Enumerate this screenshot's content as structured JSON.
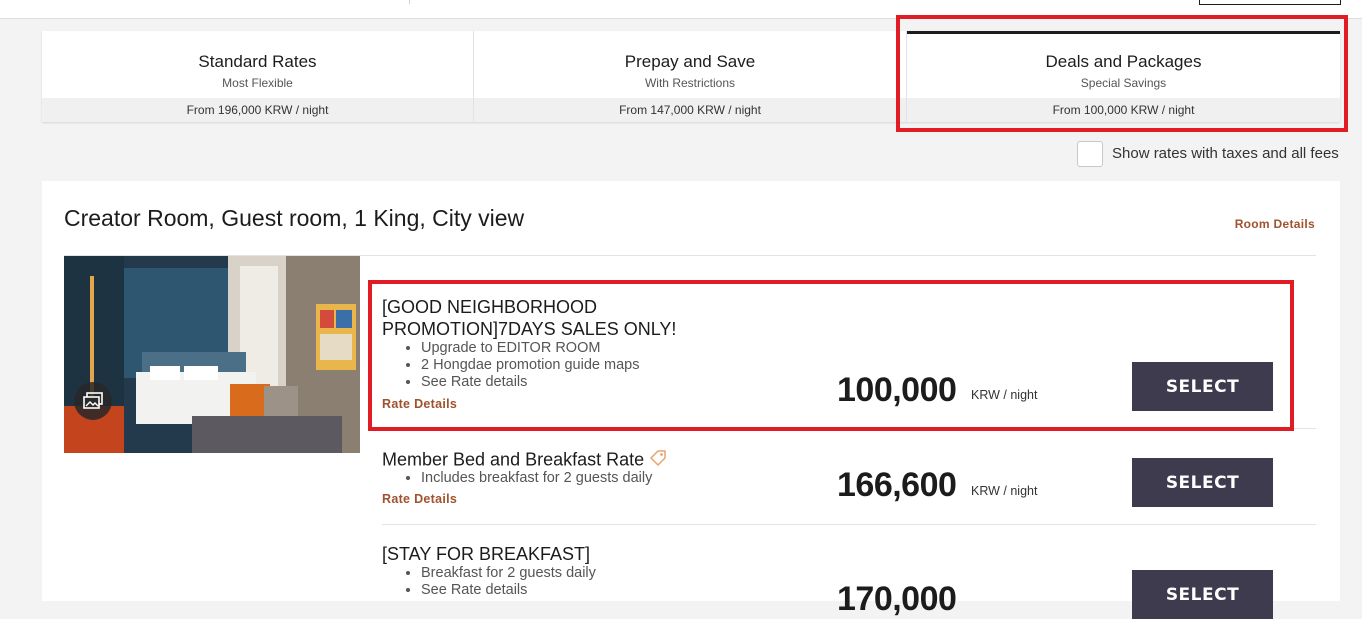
{
  "tabs": [
    {
      "title": "Standard Rates",
      "subtitle": "Most Flexible",
      "price": "From 196,000 KRW / night"
    },
    {
      "title": "Prepay and Save",
      "subtitle": "With Restrictions",
      "price": "From 147,000 KRW / night"
    },
    {
      "title": "Deals and Packages",
      "subtitle": "Special Savings",
      "price": "From 100,000 KRW / night"
    }
  ],
  "taxes_label": "Show rates with taxes and all fees",
  "room": {
    "title": "Creator Room, Guest room, 1 King, City view",
    "details_link": "Room Details"
  },
  "rates": [
    {
      "title_line1": "[GOOD NEIGHBORHOOD",
      "title_line2": "PROMOTION]7DAYS SALES ONLY!",
      "bullets": [
        "Upgrade to EDITOR ROOM",
        "2 Hongdae promotion guide maps",
        "See Rate details"
      ],
      "link": "Rate Details",
      "price": "100,000",
      "unit": "KRW / night",
      "button": "SELECT"
    },
    {
      "title": "Member Bed and Breakfast Rate",
      "bullets": [
        "Includes breakfast for 2 guests daily"
      ],
      "link": "Rate Details",
      "price": "166,600",
      "unit": "KRW / night",
      "button": "SELECT"
    },
    {
      "title": "[STAY FOR BREAKFAST]",
      "bullets": [
        "Breakfast for 2 guests daily",
        "See Rate details"
      ],
      "price": "170,000",
      "button": "SELECT"
    }
  ],
  "colors": {
    "accent_link": "#a0522d",
    "button": "#3f3b4f",
    "highlight": "#e01c24"
  }
}
